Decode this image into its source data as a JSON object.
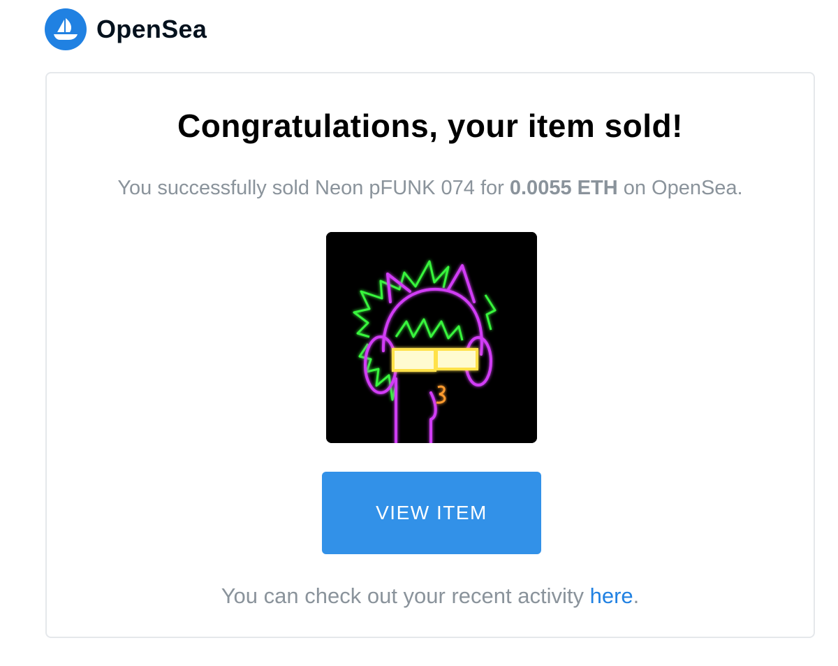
{
  "brand": {
    "name": "OpenSea",
    "logo_icon": "opensea-ship-icon",
    "color": "#2081e2"
  },
  "email": {
    "title": "Congratulations, your item sold!",
    "message_prefix": "You successfully sold Neon pFUNK 074 for ",
    "price": "0.0055 ETH",
    "message_suffix": " on OpenSea.",
    "item_image_icon": "neon-pfunk-nft-image",
    "button_label": "VIEW ITEM",
    "button_color": "#3291e8",
    "footer_prefix": "You can check out your recent activity ",
    "footer_link": "here",
    "footer_suffix": "."
  }
}
